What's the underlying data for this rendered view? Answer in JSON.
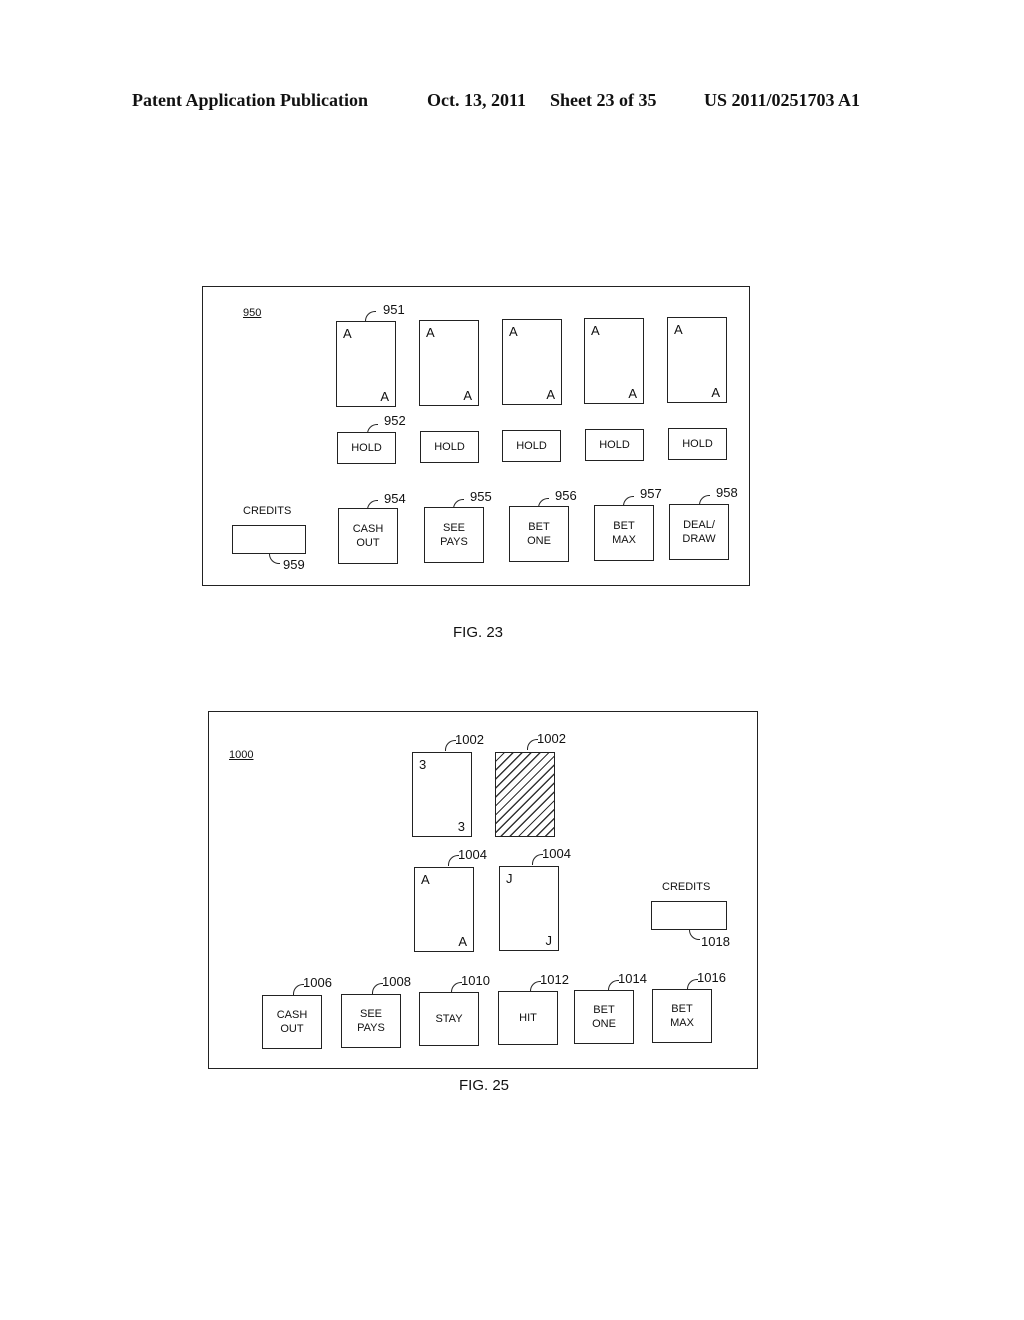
{
  "header": {
    "left": "Patent Application Publication",
    "date": "Oct. 13, 2011",
    "sheet": "Sheet 23 of 35",
    "pub_number": "US 2011/0251703 A1"
  },
  "fig23": {
    "ref": "950",
    "card_ref": "951",
    "hold_ref": "952",
    "cards": [
      {
        "rank": "A"
      },
      {
        "rank": "A"
      },
      {
        "rank": "A"
      },
      {
        "rank": "A"
      },
      {
        "rank": "A"
      }
    ],
    "hold_label": "HOLD",
    "credits_label": "CREDITS",
    "credits_ref": "959",
    "buttons": [
      {
        "label": "CASH\nOUT",
        "ref": "954"
      },
      {
        "label": "SEE\nPAYS",
        "ref": "955"
      },
      {
        "label": "BET\nONE",
        "ref": "956"
      },
      {
        "label": "BET\nMAX",
        "ref": "957"
      },
      {
        "label": "DEAL/\nDRAW",
        "ref": "958"
      }
    ],
    "caption": "FIG. 23"
  },
  "fig25": {
    "ref": "1000",
    "dealer_cards": [
      {
        "rank": "3",
        "ref": "1002",
        "face_down": false
      },
      {
        "rank": "",
        "ref": "1002",
        "face_down": true
      }
    ],
    "player_cards": [
      {
        "rank": "A",
        "ref": "1004"
      },
      {
        "rank": "J",
        "ref": "1004"
      }
    ],
    "credits_label": "CREDITS",
    "credits_ref": "1018",
    "buttons": [
      {
        "label": "CASH\nOUT",
        "ref": "1006"
      },
      {
        "label": "SEE\nPAYS",
        "ref": "1008"
      },
      {
        "label": "STAY",
        "ref": "1010"
      },
      {
        "label": "HIT",
        "ref": "1012"
      },
      {
        "label": "BET\nONE",
        "ref": "1014"
      },
      {
        "label": "BET\nMAX",
        "ref": "1016"
      }
    ],
    "caption": "FIG. 25"
  }
}
